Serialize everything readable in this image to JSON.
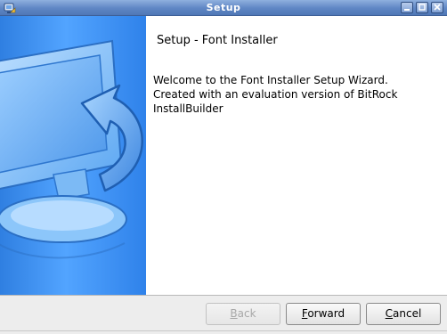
{
  "window": {
    "title": "Setup",
    "controls": [
      "minimize",
      "maximize",
      "close"
    ]
  },
  "sidebar": {
    "image": "installer-computer-arrow-graphic"
  },
  "content": {
    "heading": "Setup - Font Installer",
    "welcome_lines": [
      "Welcome to the Font Installer Setup Wizard.",
      "Created with an evaluation version of BitRock",
      "InstallBuilder"
    ]
  },
  "buttons": {
    "back": {
      "mnemonic": "B",
      "rest": "ack",
      "enabled": false
    },
    "forward": {
      "mnemonic": "F",
      "rest": "orward",
      "enabled": true
    },
    "cancel": {
      "mnemonic": "C",
      "rest": "ancel",
      "enabled": true
    }
  },
  "colors": {
    "titlebar": "#5f86c4",
    "sidebar": "#3f90f2",
    "content_bg": "#ffffff"
  }
}
